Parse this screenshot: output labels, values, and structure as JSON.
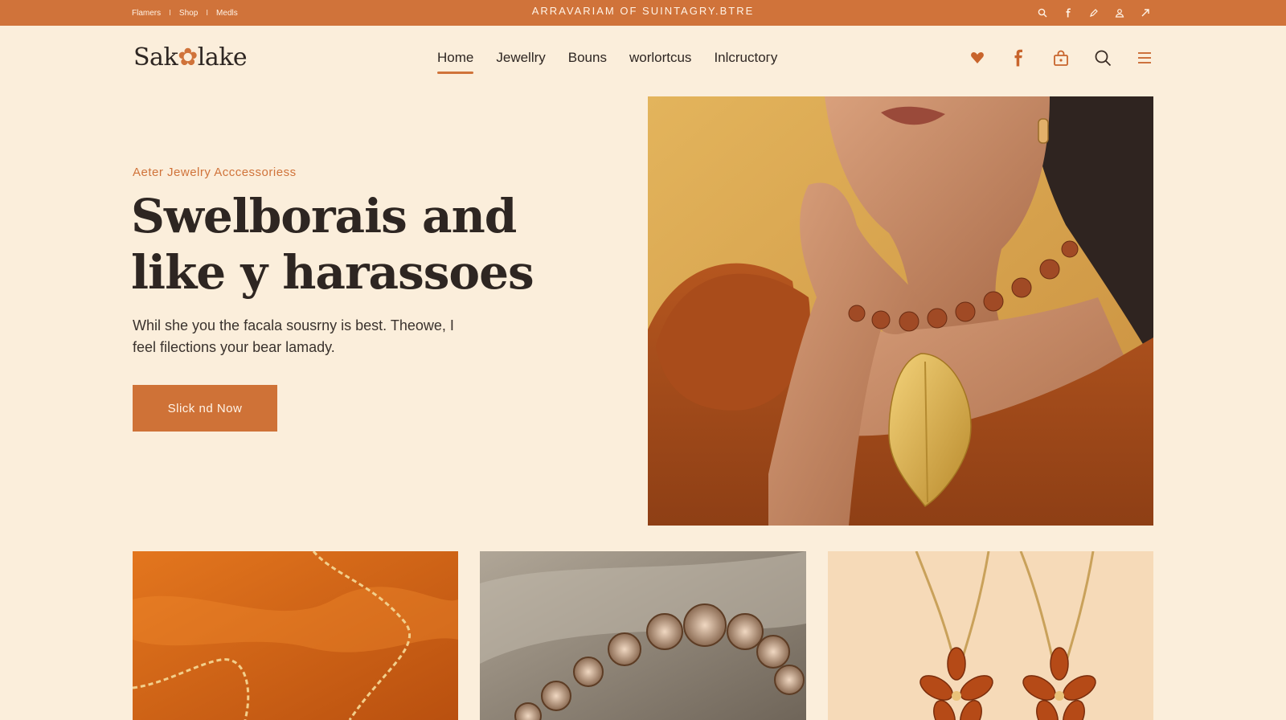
{
  "topbar": {
    "links": [
      "Flamers",
      "Shop",
      "Medls"
    ],
    "separator": "I",
    "announcement": "ARRAVARIAM OF SUINTAGRY.BTRE",
    "icons": [
      "search-icon",
      "facebook-icon",
      "edit-icon",
      "user-icon",
      "share-icon"
    ]
  },
  "header": {
    "logo_left": "Sak",
    "logo_mark": "✿",
    "logo_right": "lake",
    "nav": [
      {
        "label": "Home",
        "active": true
      },
      {
        "label": "Jewellry",
        "active": false
      },
      {
        "label": "Bouns",
        "active": false
      },
      {
        "label": "worlortcus",
        "active": false
      },
      {
        "label": "Inlcructoгy",
        "active": false
      }
    ],
    "icons": [
      "heart-icon",
      "facebook-icon",
      "bag-icon",
      "search-icon",
      "menu-icon"
    ]
  },
  "hero": {
    "eyebrow": "Aeter Jewelry Acccessoriess",
    "headline_line1": "Swelborais and",
    "headline_line2": "like y harassoes",
    "body_line1": "Whil she you the facala sousrny is best. Theowe, I",
    "body_line2": "feel filections your bear lamady.",
    "cta_label": "Slick nd Now"
  },
  "colors": {
    "accent": "#d0733a",
    "background": "#fbeedb",
    "text": "#2e2622"
  }
}
